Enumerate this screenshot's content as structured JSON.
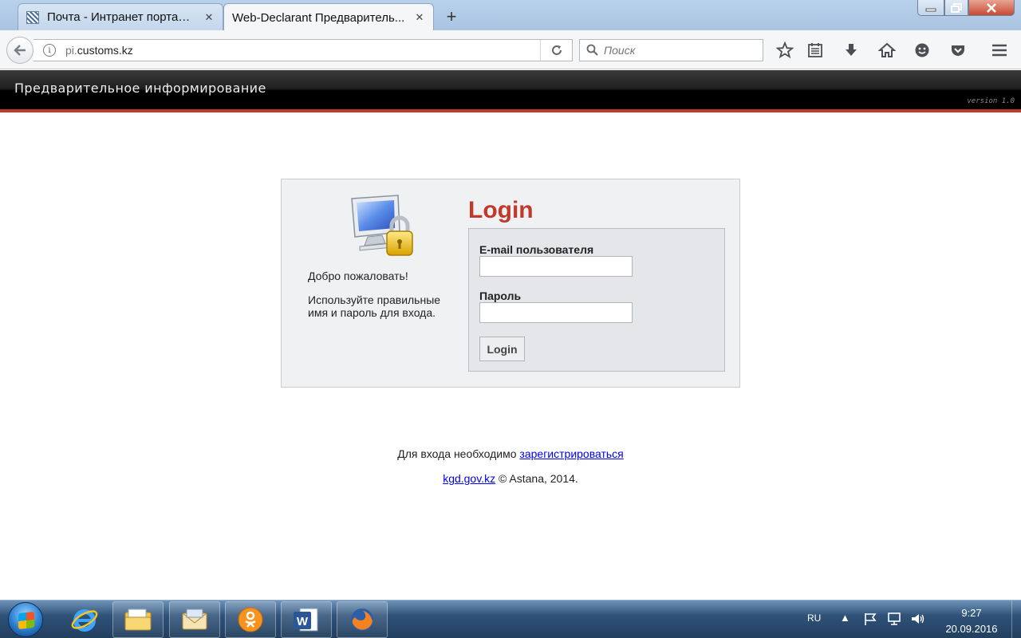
{
  "browser": {
    "tabs": [
      {
        "title": "Почта - Интранет портал ...",
        "active": false
      },
      {
        "title": "Web-Declarant Предваритель...",
        "active": true
      }
    ],
    "tab_close_glyph": "✕",
    "new_tab_glyph": "+",
    "url": {
      "dim": "pi.",
      "host": "customs.kz"
    },
    "search_placeholder": "Поиск",
    "toolbar_icons": [
      "bookmark-star-icon",
      "reading-list-icon",
      "download-icon",
      "home-icon",
      "hello-icon",
      "pocket-icon",
      "menu-icon"
    ]
  },
  "site": {
    "title": "Предварительное информирование",
    "version": "version 1.0",
    "accent_color": "#c0392b"
  },
  "login": {
    "welcome": "Добро пожаловать!",
    "hint": "Используйте правильные имя и пароль для входа.",
    "heading": "Login",
    "email_label": "E-mail пользователя",
    "password_label": "Пароль",
    "button": "Login"
  },
  "footer": {
    "register_prefix": "Для входа необходимо",
    "register_link": "зарегистрироваться",
    "site_link": "kgd.gov.kz",
    "copyright": "© Astana, 2014."
  },
  "taskbar": {
    "language": "RU",
    "time": "9:27",
    "date": "20.09.2016",
    "apps": [
      "internet-explorer-icon",
      "file-explorer-icon",
      "email-app-icon",
      "odnoklassniki-icon",
      "word-icon",
      "firefox-icon"
    ]
  }
}
